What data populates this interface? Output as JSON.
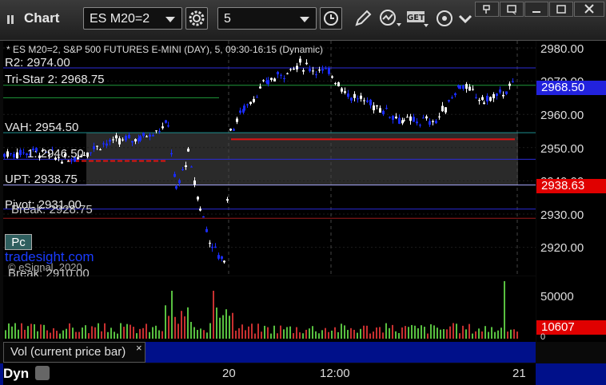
{
  "window": {
    "title": "Chart"
  },
  "toolbar": {
    "symbol": "ES M20=2",
    "interval": "5",
    "get_label": "GET"
  },
  "header": {
    "description": "* ES M20=2, S&P 500 FUTURES E-MINI (DAY), 5, 09:30-16:15 (Dynamic)"
  },
  "levels": {
    "r2": "R2: 2974.00",
    "tristar": "Tri-Star 2: 2968.75",
    "vah": "VAH: 2954.50",
    "r1": "1: 2946.50",
    "upt": "UPT: 2938.75",
    "pivot": "Pivot: 2931.00",
    "pbreak": "Break: 2928.75",
    "dbreak": "Break: 2910.00"
  },
  "pc_label": "Pc",
  "brand": "tradesight.com",
  "copyright": "© eSignal, 2020",
  "y_axis": {
    "ticks": [
      "2980.00",
      "2970.00",
      "2960.00",
      "2950.00",
      "2940.00",
      "2930.00",
      "2920.00"
    ]
  },
  "price_tags": {
    "last": "2968.50",
    "upt": "2938.63",
    "volume": "10607"
  },
  "vol_axis": {
    "tick": "50000",
    "zero": "0"
  },
  "vol_panel": {
    "label": "Vol (current price bar)",
    "close": "×"
  },
  "time_axis": {
    "ticks": [
      "20",
      "12:00",
      "21"
    ]
  },
  "bottom": {
    "dyn": "Dyn"
  },
  "colors": {
    "up": "#ffffff",
    "down": "#1a2cff",
    "level_blue": "#2b2bd8",
    "level_green": "#1f9a3a",
    "level_red": "#e01414",
    "tag_red": "#e00000",
    "tag_blue": "#2222dd"
  }
}
